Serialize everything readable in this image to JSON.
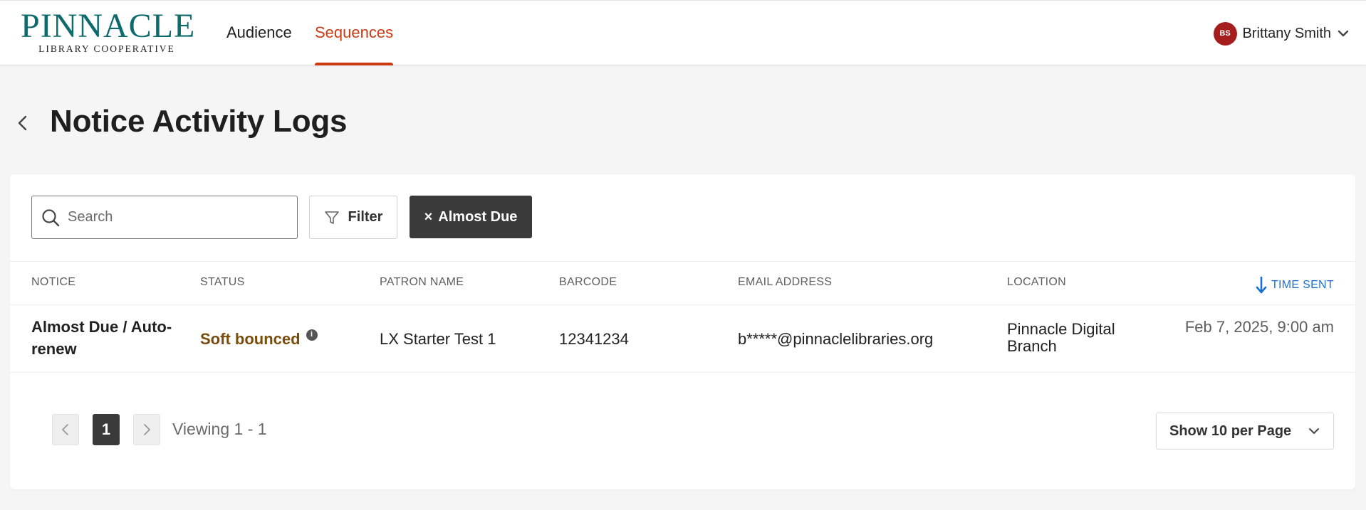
{
  "brand": {
    "name": "PINNACLE",
    "subtitle": "LIBRARY COOPERATIVE",
    "color": "#0e6b6b"
  },
  "nav": {
    "tabs": [
      {
        "label": "Audience",
        "active": false
      },
      {
        "label": "Sequences",
        "active": true
      }
    ],
    "accent": "#cc3a14"
  },
  "user": {
    "initials": "BS",
    "name": "Brittany Smith",
    "avatar_color": "#a51d1d"
  },
  "page": {
    "title": "Notice Activity Logs"
  },
  "toolbar": {
    "search_placeholder": "Search",
    "filter_label": "Filter",
    "active_chip": {
      "label": "Almost Due",
      "remove_glyph": "×"
    }
  },
  "table": {
    "columns": [
      "NOTICE",
      "STATUS",
      "PATRON NAME",
      "BARCODE",
      "EMAIL ADDRESS",
      "LOCATION",
      "TIME SENT"
    ],
    "sort": {
      "column": "TIME SENT",
      "direction": "descending",
      "icon": "arrow-down-icon"
    },
    "rows": [
      {
        "notice": "Almost Due / Auto-renew",
        "status": "Soft bounced",
        "status_color": "#7a4d0c",
        "patron_name": "LX Starter Test 1",
        "barcode": "12341234",
        "email": "b*****@pinnaclelibraries.org",
        "location": "Pinnacle Digital Branch",
        "time_sent": "Feb 7, 2025, 9:00 am"
      }
    ]
  },
  "pagination": {
    "current_page": "1",
    "viewing": "Viewing 1 - 1",
    "per_page_label": "Show 10 per Page"
  }
}
